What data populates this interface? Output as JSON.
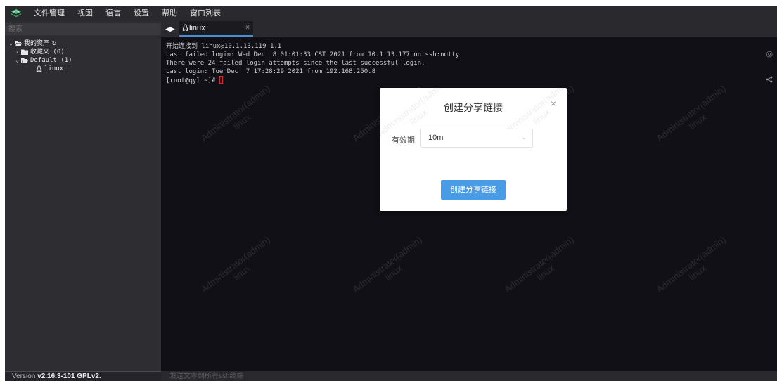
{
  "menubar": {
    "items": [
      "文件管理",
      "视图",
      "语言",
      "设置",
      "帮助",
      "窗口列表"
    ]
  },
  "sidebar": {
    "search_placeholder": "搜索",
    "tree": {
      "root": "我的资产",
      "favorites": "收藏夹 (0)",
      "default": "Default (1)",
      "host": "linux"
    },
    "version_prefix": "Version ",
    "version": "v2.16.3-101 GPLv2."
  },
  "tab": {
    "label": "linux",
    "close": "×"
  },
  "terminal": {
    "lines": [
      "开始连接到 linux@10.1.13.119 1.1",
      "Last failed login: Wed Dec  8 01:01:33 CST 2021 from 10.1.13.177 on ssh:notty",
      "There were 24 failed login attempts since the last successful login.",
      "Last login: Tue Dec  7 17:28:29 2021 from 192.168.250.8"
    ],
    "prompt": "[root@qyl ~]# ",
    "watermark_line1": "Administrator(admin)",
    "watermark_line2": "linux"
  },
  "command_bar": {
    "placeholder": "发送文本到所有ssh终端"
  },
  "modal": {
    "title": "创建分享链接",
    "close": "×",
    "validity_label": "有效期",
    "validity_value": "10m",
    "submit": "创建分享链接"
  },
  "colors": {
    "accent": "#4a9be6",
    "terminal_bg": "#101016",
    "sidebar_bg": "#2d2d32",
    "cursor": "#d62a2a"
  }
}
